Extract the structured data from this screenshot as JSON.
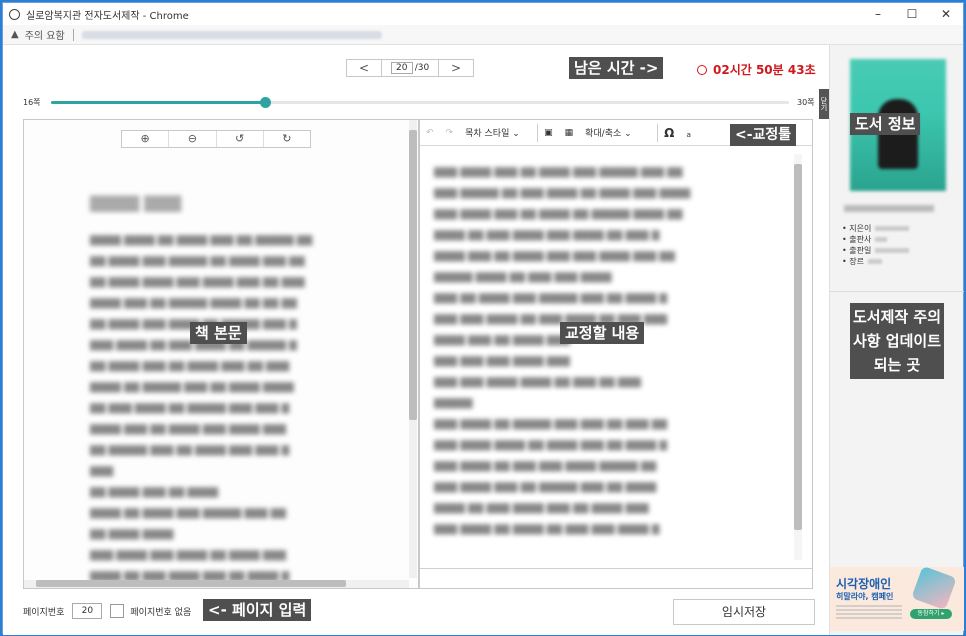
{
  "window": {
    "title": "실로암복지관 전자도서제작 - Chrome",
    "controls": {
      "minimize": "–",
      "maximize": "☐",
      "close": "✕"
    }
  },
  "address_bar": {
    "warning_icon": "warning-icon",
    "warning_text": "주의 요함"
  },
  "pager": {
    "prev": "<",
    "next": ">",
    "current_page": "20",
    "total": "/30"
  },
  "timer": {
    "label": "남은 시간 ->",
    "value": "02시간 50분 43초"
  },
  "progress": {
    "start_label": "16쪽",
    "end_label": "30쪽",
    "fraction": 0.29
  },
  "side_close_tab": "닫기",
  "book_tools": {
    "zoom_in": "⊕",
    "zoom_out": "⊖",
    "rotate_left": "↺",
    "rotate_right": "↻"
  },
  "book_panel_label": "책 본문",
  "editor": {
    "label": "교정할 내용",
    "toolbar": {
      "undo": "↶",
      "redo": "↷",
      "style_select": "목차 스타일",
      "image": "image-icon",
      "table": "table-icon",
      "zoom_select": "확대/축소",
      "omega": "Ω",
      "special": "ₐ"
    },
    "toolbar_label": "<-교정툴"
  },
  "footer": {
    "page_number_label": "페이지번호",
    "page_number_value": "20",
    "no_page_number_label": "페이지번호 없음",
    "page_input_label": "<- 페이지 입력",
    "save_button": "임시저장"
  },
  "sidebar": {
    "book_info_label": "도서 정보",
    "meta_items": [
      "• 지은이",
      "• 출판사",
      "• 출판일",
      "• 장르"
    ],
    "notice_label": "도서제작 주의사항 업데이트 되는 곳",
    "ad": {
      "title": "시각장애인",
      "subtitle": "히말라야, 캠페인",
      "button": "동참하기 ▸"
    }
  },
  "colors": {
    "accent": "#2fa3a1",
    "timer": "#d0191e",
    "label_bg": "#4f4f4f"
  }
}
